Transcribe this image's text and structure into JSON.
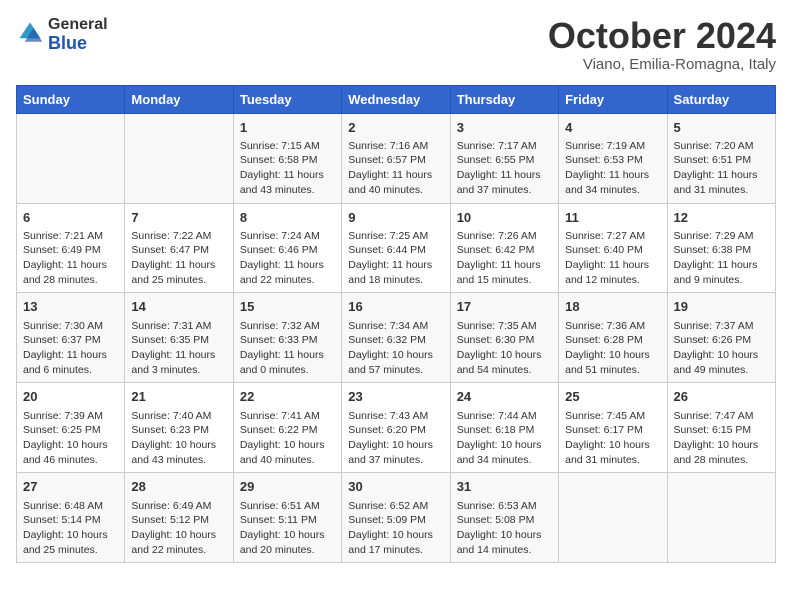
{
  "header": {
    "logo_general": "General",
    "logo_blue": "Blue",
    "month_title": "October 2024",
    "location": "Viano, Emilia-Romagna, Italy"
  },
  "weekdays": [
    "Sunday",
    "Monday",
    "Tuesday",
    "Wednesday",
    "Thursday",
    "Friday",
    "Saturday"
  ],
  "weeks": [
    [
      {
        "day": "",
        "info": ""
      },
      {
        "day": "",
        "info": ""
      },
      {
        "day": "1",
        "info": "Sunrise: 7:15 AM\nSunset: 6:58 PM\nDaylight: 11 hours and 43 minutes."
      },
      {
        "day": "2",
        "info": "Sunrise: 7:16 AM\nSunset: 6:57 PM\nDaylight: 11 hours and 40 minutes."
      },
      {
        "day": "3",
        "info": "Sunrise: 7:17 AM\nSunset: 6:55 PM\nDaylight: 11 hours and 37 minutes."
      },
      {
        "day": "4",
        "info": "Sunrise: 7:19 AM\nSunset: 6:53 PM\nDaylight: 11 hours and 34 minutes."
      },
      {
        "day": "5",
        "info": "Sunrise: 7:20 AM\nSunset: 6:51 PM\nDaylight: 11 hours and 31 minutes."
      }
    ],
    [
      {
        "day": "6",
        "info": "Sunrise: 7:21 AM\nSunset: 6:49 PM\nDaylight: 11 hours and 28 minutes."
      },
      {
        "day": "7",
        "info": "Sunrise: 7:22 AM\nSunset: 6:47 PM\nDaylight: 11 hours and 25 minutes."
      },
      {
        "day": "8",
        "info": "Sunrise: 7:24 AM\nSunset: 6:46 PM\nDaylight: 11 hours and 22 minutes."
      },
      {
        "day": "9",
        "info": "Sunrise: 7:25 AM\nSunset: 6:44 PM\nDaylight: 11 hours and 18 minutes."
      },
      {
        "day": "10",
        "info": "Sunrise: 7:26 AM\nSunset: 6:42 PM\nDaylight: 11 hours and 15 minutes."
      },
      {
        "day": "11",
        "info": "Sunrise: 7:27 AM\nSunset: 6:40 PM\nDaylight: 11 hours and 12 minutes."
      },
      {
        "day": "12",
        "info": "Sunrise: 7:29 AM\nSunset: 6:38 PM\nDaylight: 11 hours and 9 minutes."
      }
    ],
    [
      {
        "day": "13",
        "info": "Sunrise: 7:30 AM\nSunset: 6:37 PM\nDaylight: 11 hours and 6 minutes."
      },
      {
        "day": "14",
        "info": "Sunrise: 7:31 AM\nSunset: 6:35 PM\nDaylight: 11 hours and 3 minutes."
      },
      {
        "day": "15",
        "info": "Sunrise: 7:32 AM\nSunset: 6:33 PM\nDaylight: 11 hours and 0 minutes."
      },
      {
        "day": "16",
        "info": "Sunrise: 7:34 AM\nSunset: 6:32 PM\nDaylight: 10 hours and 57 minutes."
      },
      {
        "day": "17",
        "info": "Sunrise: 7:35 AM\nSunset: 6:30 PM\nDaylight: 10 hours and 54 minutes."
      },
      {
        "day": "18",
        "info": "Sunrise: 7:36 AM\nSunset: 6:28 PM\nDaylight: 10 hours and 51 minutes."
      },
      {
        "day": "19",
        "info": "Sunrise: 7:37 AM\nSunset: 6:26 PM\nDaylight: 10 hours and 49 minutes."
      }
    ],
    [
      {
        "day": "20",
        "info": "Sunrise: 7:39 AM\nSunset: 6:25 PM\nDaylight: 10 hours and 46 minutes."
      },
      {
        "day": "21",
        "info": "Sunrise: 7:40 AM\nSunset: 6:23 PM\nDaylight: 10 hours and 43 minutes."
      },
      {
        "day": "22",
        "info": "Sunrise: 7:41 AM\nSunset: 6:22 PM\nDaylight: 10 hours and 40 minutes."
      },
      {
        "day": "23",
        "info": "Sunrise: 7:43 AM\nSunset: 6:20 PM\nDaylight: 10 hours and 37 minutes."
      },
      {
        "day": "24",
        "info": "Sunrise: 7:44 AM\nSunset: 6:18 PM\nDaylight: 10 hours and 34 minutes."
      },
      {
        "day": "25",
        "info": "Sunrise: 7:45 AM\nSunset: 6:17 PM\nDaylight: 10 hours and 31 minutes."
      },
      {
        "day": "26",
        "info": "Sunrise: 7:47 AM\nSunset: 6:15 PM\nDaylight: 10 hours and 28 minutes."
      }
    ],
    [
      {
        "day": "27",
        "info": "Sunrise: 6:48 AM\nSunset: 5:14 PM\nDaylight: 10 hours and 25 minutes."
      },
      {
        "day": "28",
        "info": "Sunrise: 6:49 AM\nSunset: 5:12 PM\nDaylight: 10 hours and 22 minutes."
      },
      {
        "day": "29",
        "info": "Sunrise: 6:51 AM\nSunset: 5:11 PM\nDaylight: 10 hours and 20 minutes."
      },
      {
        "day": "30",
        "info": "Sunrise: 6:52 AM\nSunset: 5:09 PM\nDaylight: 10 hours and 17 minutes."
      },
      {
        "day": "31",
        "info": "Sunrise: 6:53 AM\nSunset: 5:08 PM\nDaylight: 10 hours and 14 minutes."
      },
      {
        "day": "",
        "info": ""
      },
      {
        "day": "",
        "info": ""
      }
    ]
  ]
}
